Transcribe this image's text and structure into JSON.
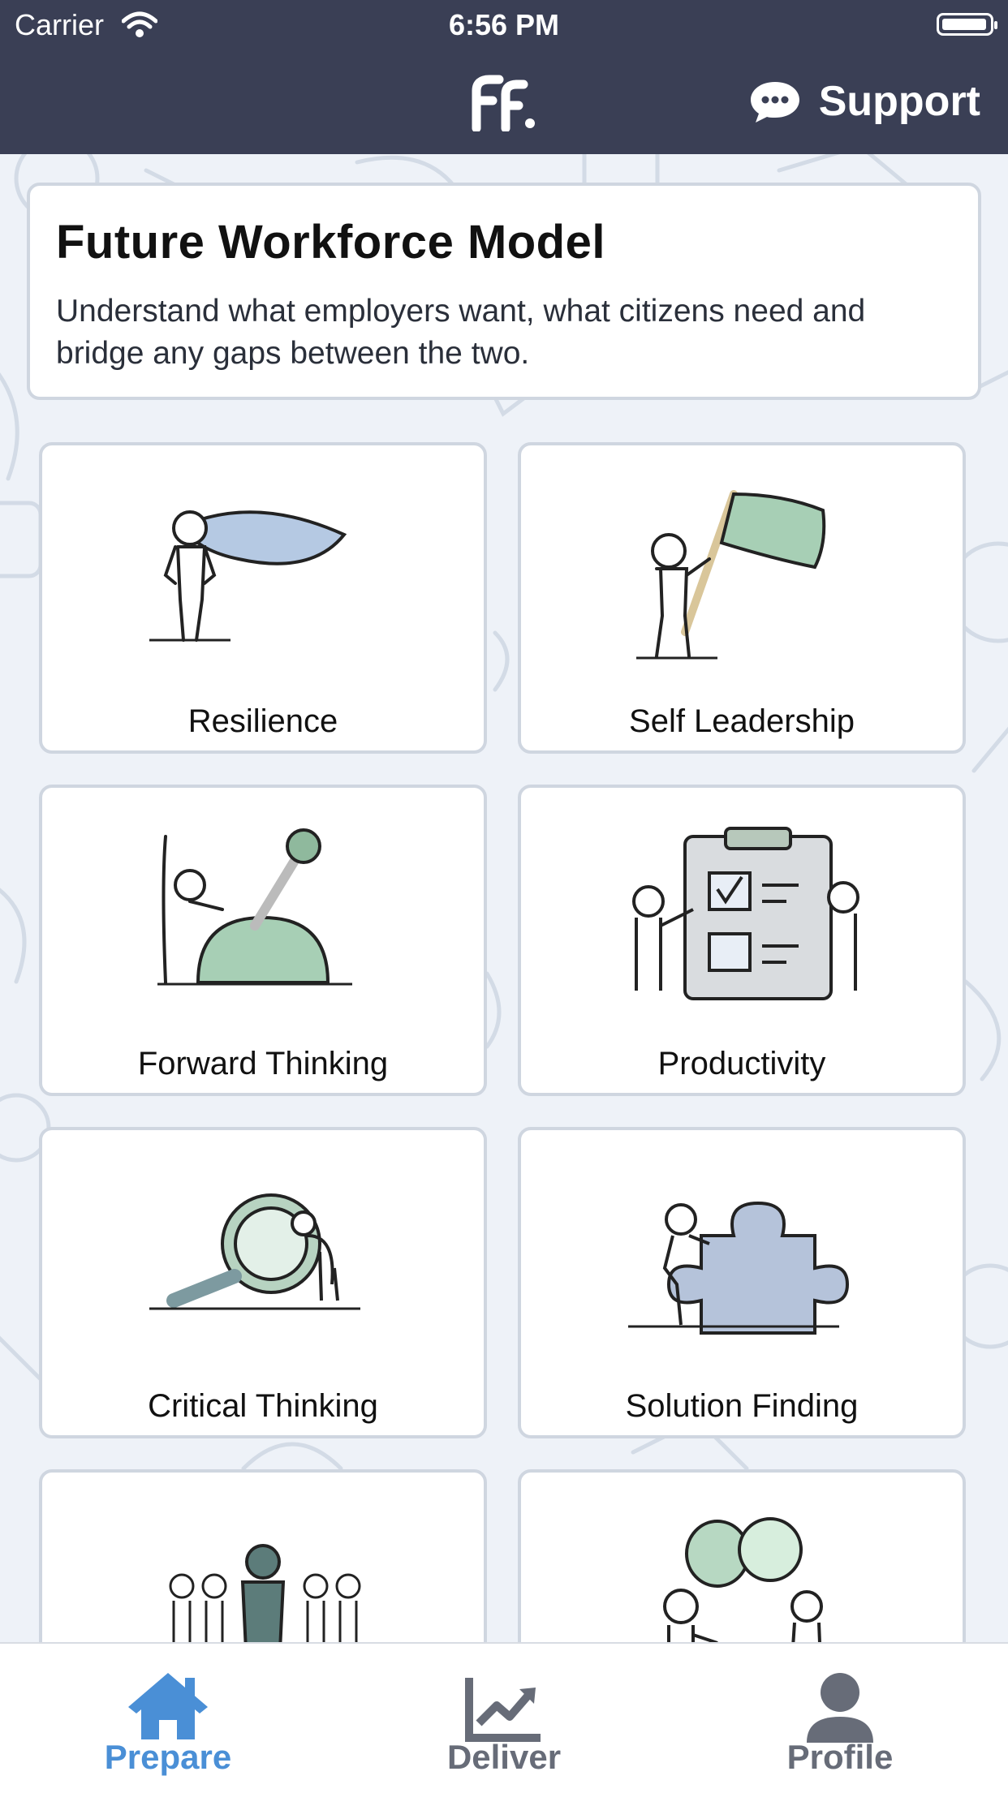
{
  "status_bar": {
    "carrier": "Carrier",
    "time": "6:56 PM"
  },
  "header": {
    "logo_icon": "ff-logo-icon",
    "support_label": "Support",
    "support_icon": "chat-bubble-icon"
  },
  "intro": {
    "title": "Future Workforce Model",
    "description": "Understand what employers want, what citizens need and bridge any gaps between the two."
  },
  "tiles": [
    {
      "label": "Resilience",
      "icon": "superhero-cape-icon"
    },
    {
      "label": "Self Leadership",
      "icon": "flag-bearer-icon"
    },
    {
      "label": "Forward Thinking",
      "icon": "lever-icon"
    },
    {
      "label": "Productivity",
      "icon": "clipboard-checklist-icon"
    },
    {
      "label": "Critical Thinking",
      "icon": "magnifying-glass-icon"
    },
    {
      "label": "Solution Finding",
      "icon": "puzzle-piece-icon"
    },
    {
      "label": "",
      "icon": "team-leader-icon"
    },
    {
      "label": "",
      "icon": "speech-bubbles-icon"
    }
  ],
  "tabbar": {
    "tabs": [
      {
        "label": "Prepare",
        "icon": "home-icon",
        "active": true
      },
      {
        "label": "Deliver",
        "icon": "chart-icon",
        "active": false
      },
      {
        "label": "Profile",
        "icon": "person-icon",
        "active": false
      }
    ]
  },
  "colors": {
    "header_bg": "#3a3f55",
    "accent": "#4a8fd6",
    "inactive_tab": "#676c78",
    "tile_border": "#cfd6e0"
  }
}
